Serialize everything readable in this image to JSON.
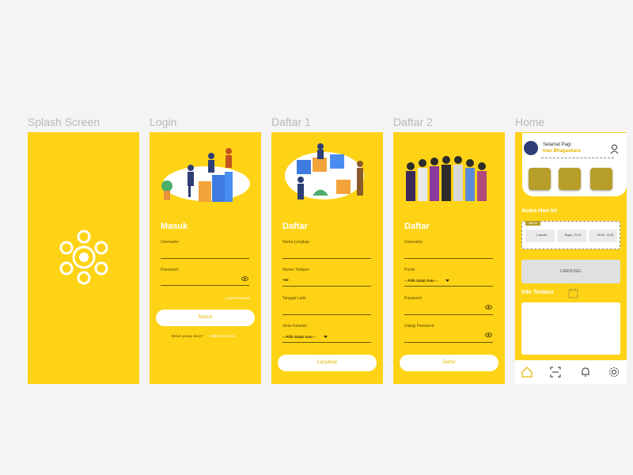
{
  "frames": {
    "splash": {
      "label": "Splash Screen"
    },
    "login": {
      "label": "Login",
      "heading": "Masuk",
      "username_label": "Username",
      "password_label": "Password",
      "forgot": "Lupa Password",
      "button": "Masuk",
      "signup_prompt": "Belum punya akun?",
      "signup_link": "Daftar disini yuk"
    },
    "daftar1": {
      "label": "Daftar 1",
      "heading": "Daftar",
      "name_label": "Nama Lengkap",
      "phone_label": "Nomor Telepon",
      "phone_value": "+62",
      "dob_label": "Tanggal Lahir",
      "gender_label": "Jenis Kelamin",
      "gender_value": "-- Pilih Salah Satu --",
      "button": "Lanjutkan"
    },
    "daftar2": {
      "label": "Daftar 2",
      "heading": "Daftar",
      "username_label": "Username",
      "position_label": "Posisi",
      "position_value": "-- Pilih Salah Satu --",
      "password_label": "Password",
      "confirm_label": "Ulangi Password",
      "button": "Daftar"
    },
    "home": {
      "label": "Home",
      "greeting": "Selamat Pagi",
      "user_name": "Ivan Bhagaskara",
      "section_today": "Acara Hari Ini",
      "badge": "Hari ini",
      "event_date": "1 Januari",
      "event_place": "Bogor, ITI 34",
      "event_time": "09.00 - 11.00",
      "carousel": "CAROUSEL",
      "section_info": "Info Terbaru"
    }
  },
  "colors": {
    "yellow": "#fed316",
    "white": "#ffffff",
    "label_gray": "#b9b9b9"
  }
}
